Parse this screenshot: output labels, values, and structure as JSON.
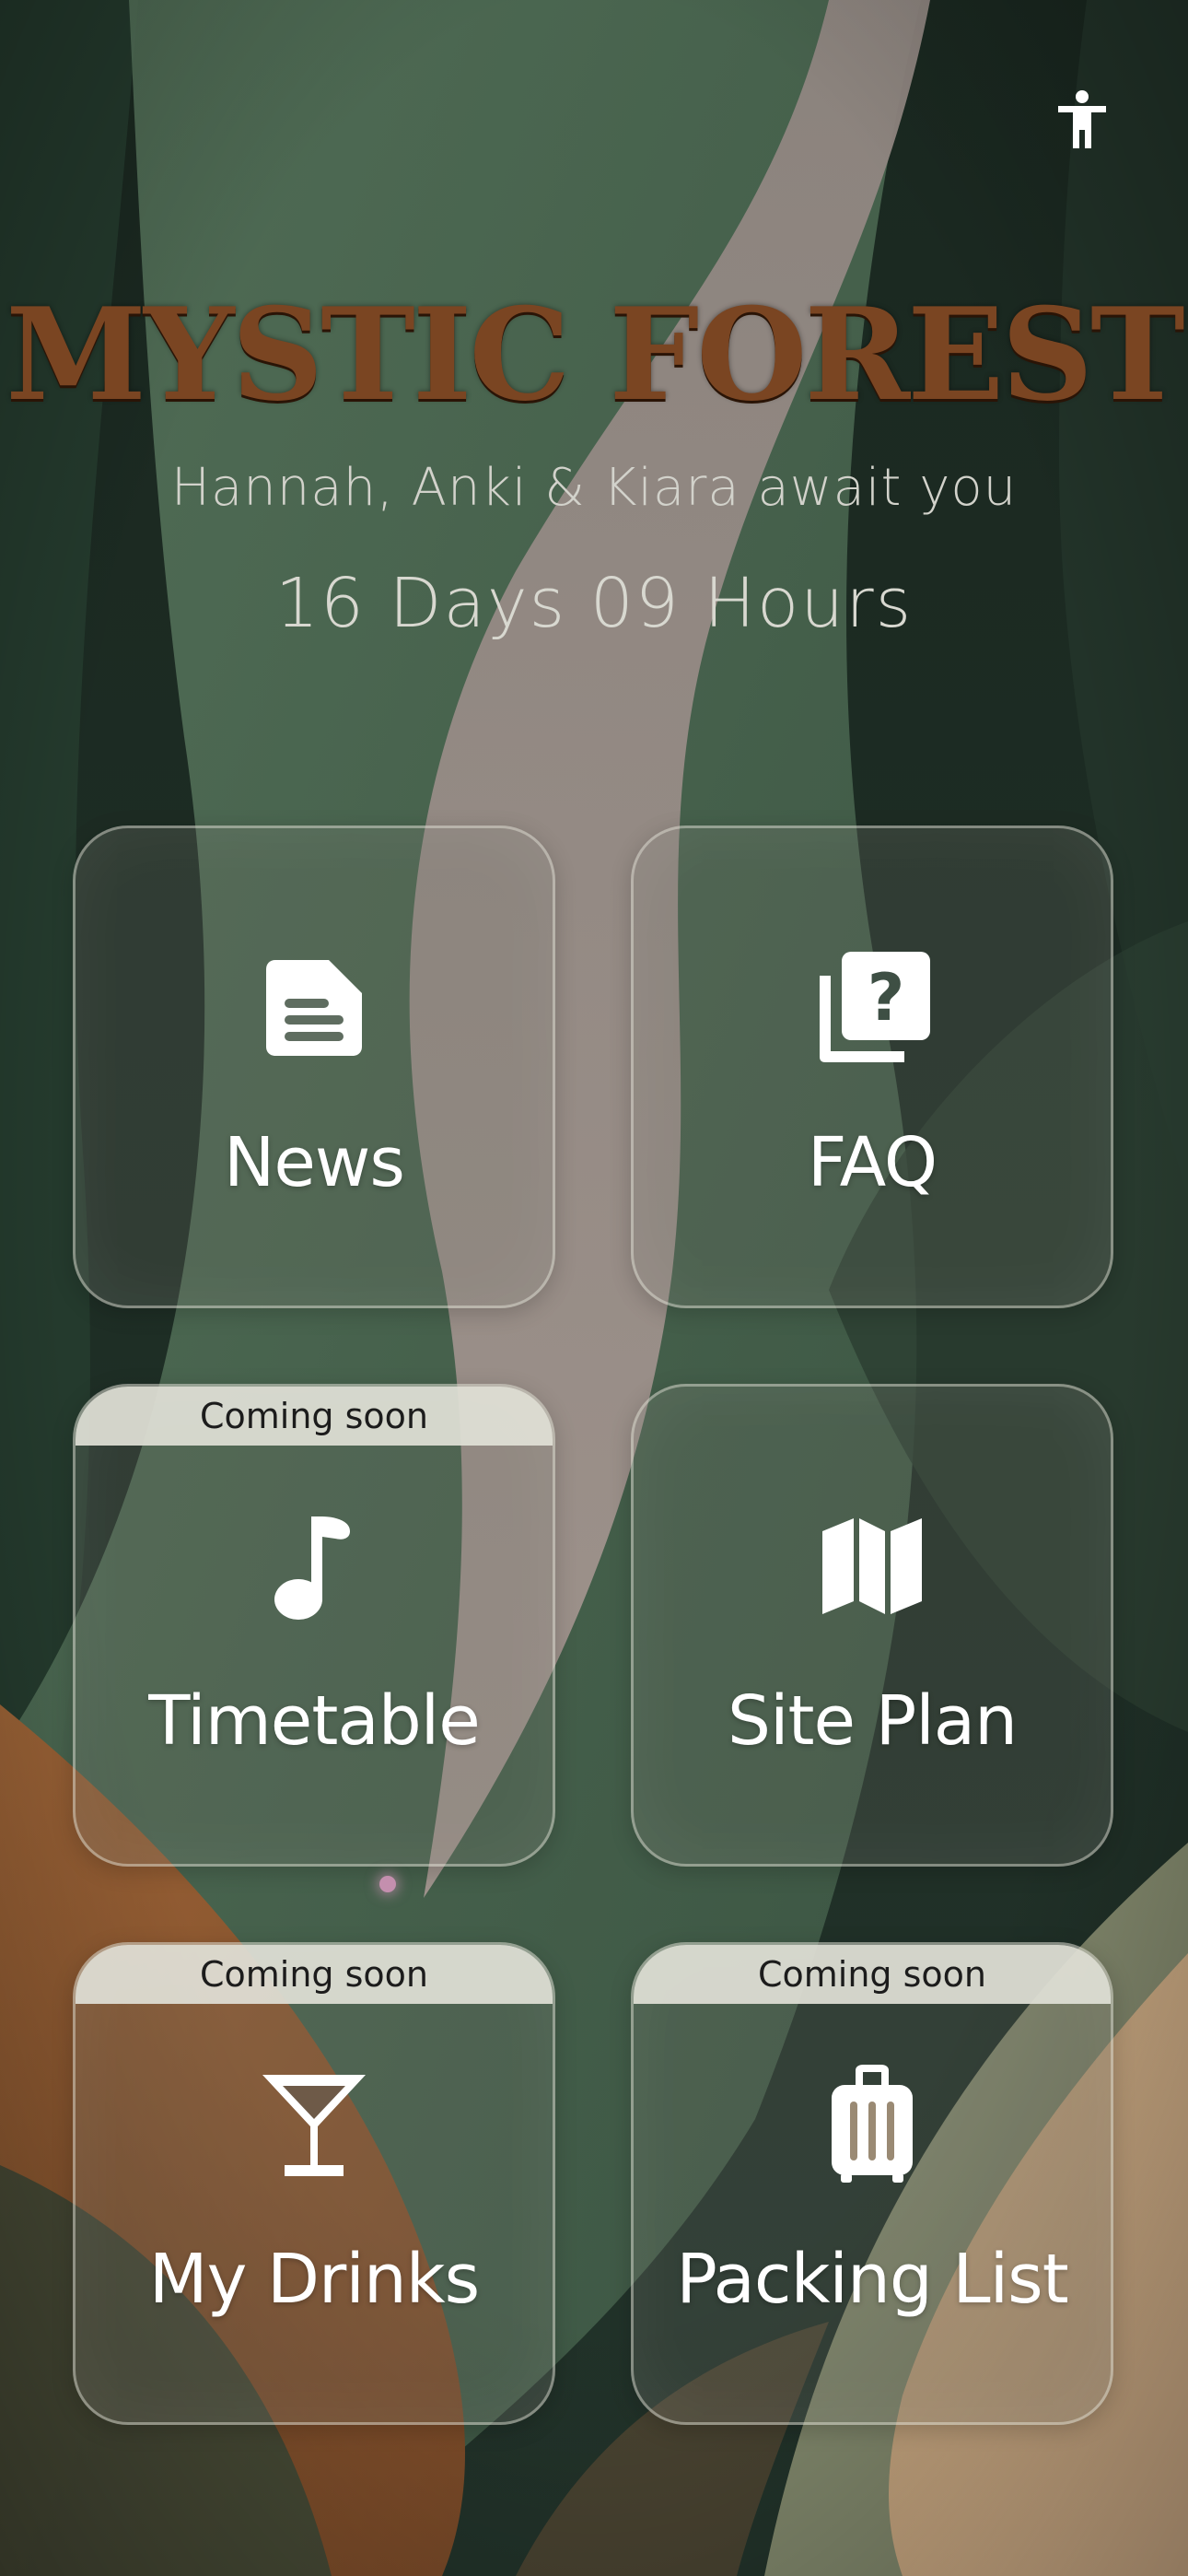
{
  "header": {
    "title": "MYSTIC FOREST",
    "subtitle": "Hannah, Anki & Kiara await you",
    "countdown": "16 Days 09 Hours"
  },
  "accessibility_button": {
    "icon": "accessibility-person-icon"
  },
  "tiles": [
    {
      "label": "News",
      "icon": "newspaper-document-icon",
      "ribbon": ""
    },
    {
      "label": "FAQ",
      "icon": "faq-question-icon",
      "ribbon": ""
    },
    {
      "label": "Timetable",
      "icon": "music-note-icon",
      "ribbon": "Coming soon"
    },
    {
      "label": "Site Plan",
      "icon": "map-icon",
      "ribbon": ""
    },
    {
      "label": "My Drinks",
      "icon": "cocktail-glass-icon",
      "ribbon": "Coming soon"
    },
    {
      "label": "Packing List",
      "icon": "suitcase-icon",
      "ribbon": "Coming soon"
    }
  ],
  "colors": {
    "title": "#7a4522",
    "forest_dark": "#1e2c24",
    "forest_green": "#4f6a55",
    "mauve": "#9b8c86",
    "earth_brown": "#8a5630",
    "sand": "#c9a882"
  }
}
